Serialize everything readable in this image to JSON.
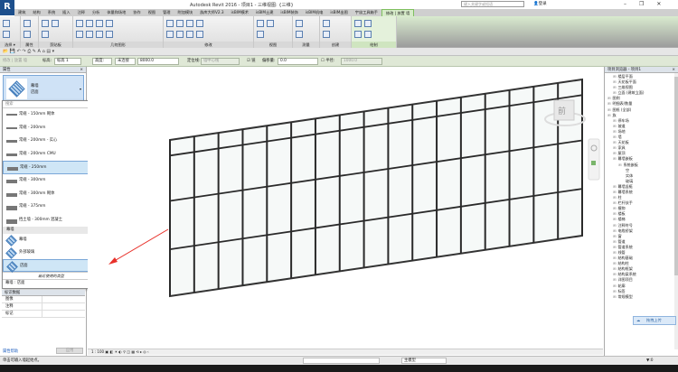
{
  "app": {
    "title": "Autodesk Revit 2016 -     项目1 - 三维视图: {三维}",
    "search_placeholder": "键入关键字或短语",
    "login": "登录",
    "accent": "#7fbf5f"
  },
  "tabs": [
    "建筑",
    "结构",
    "系统",
    "插入",
    "注释",
    "分析",
    "体量和场地",
    "协作",
    "视图",
    "管理",
    "附加模块",
    "族库大师V2.3",
    "isBIM模术",
    "isBIM土建",
    "isBIM装饰",
    "isBIM机电",
    "isBIM出图",
    "宇宙工具箱手",
    "修改 | 放置 墙"
  ],
  "active_tab": 18,
  "ribbon_panels": [
    {
      "label": "选择 ▾",
      "buttons": [
        "修改"
      ]
    },
    {
      "label": "属性",
      "buttons": []
    },
    {
      "label": "剪贴板",
      "buttons": [
        "粘贴"
      ]
    },
    {
      "label": "几何图形",
      "buttons": [
        "连接端切割",
        "剪切",
        "连接"
      ]
    },
    {
      "label": "修改",
      "buttons": []
    },
    {
      "label": "视图",
      "buttons": []
    },
    {
      "label": "测量",
      "buttons": []
    },
    {
      "label": "创建",
      "buttons": []
    },
    {
      "label": "绘制",
      "buttons": []
    }
  ],
  "options": {
    "mode": "修改 | 放置 墙",
    "level_label": "标高:",
    "level_value": "标高 1",
    "height_label": "高度:",
    "height_mode": "未连接",
    "height_value": "8000.0",
    "locline_label": "定位线:",
    "locline_value": "墙中心线",
    "chain_label": "链",
    "chain_checked": true,
    "offset_label": "偏移量:",
    "offset_value": "0.0",
    "radius_label": "半径:",
    "radius_checked": false,
    "radius_value": "1000.0"
  },
  "properties": {
    "title": "属性",
    "type_family": "幕墙",
    "type_name": "店面",
    "search_placeholder": "搜索",
    "types": [
      {
        "label": "常规 - 150mm 砌体"
      },
      {
        "label": "常规 - 200mm"
      },
      {
        "label": "常规 - 200mm - 实心"
      },
      {
        "label": "常规 - 200mm CMU"
      },
      {
        "label": "常规 - 250mm",
        "selected": true
      },
      {
        "label": "常规 - 300mm"
      },
      {
        "label": "常规 - 300mm 砌体"
      },
      {
        "label": "常规 - 375mm"
      },
      {
        "label": "挡土墙 - 300mm 混凝土"
      }
    ],
    "group": "幕墙",
    "families": [
      {
        "label": "幕墙"
      },
      {
        "label": "外部玻璃"
      },
      {
        "label": "店面",
        "selected": true
      }
    ],
    "recent": "最近使用的类型",
    "current": "幕墙 : 店面",
    "section": "标识数据",
    "rows": [
      {
        "name": "图像",
        "value": ""
      },
      {
        "name": "注释",
        "value": ""
      },
      {
        "name": "标记",
        "value": ""
      }
    ],
    "help": "属性帮助",
    "apply": "应用"
  },
  "view": {
    "scale": "1 : 100",
    "viewcube_face": "前",
    "annotation_color": "#e8312a",
    "curtain_wall": {
      "columns": 17,
      "row_grid_fractions": [
        0.1,
        0.39,
        0.7
      ]
    }
  },
  "browser": {
    "title": "项目浏览器 - 项目1",
    "items": [
      {
        "label": "楼层平面",
        "level": 1
      },
      {
        "label": "天花板平面",
        "level": 1
      },
      {
        "label": "三维视图",
        "level": 1
      },
      {
        "label": "立面 (建筑立面)",
        "level": 1
      },
      {
        "label": "图例",
        "level": 0
      },
      {
        "label": "明细表/数量",
        "level": 0
      },
      {
        "label": "图纸 (全部)",
        "level": 0
      },
      {
        "label": "族",
        "level": 0
      },
      {
        "label": "停车场",
        "level": 1
      },
      {
        "label": "坡道",
        "level": 1
      },
      {
        "label": "场地",
        "level": 1
      },
      {
        "label": "墙",
        "level": 1
      },
      {
        "label": "天花板",
        "level": 1
      },
      {
        "label": "家具",
        "level": 1
      },
      {
        "label": "屋顶",
        "level": 1
      },
      {
        "label": "幕墙嵌板",
        "level": 1
      },
      {
        "label": "系统嵌板",
        "level": 2
      },
      {
        "label": "空",
        "level": 3
      },
      {
        "label": "实体",
        "level": 3
      },
      {
        "label": "玻璃",
        "level": 3
      },
      {
        "label": "幕墙竖梃",
        "level": 1
      },
      {
        "label": "幕墙系统",
        "level": 1
      },
      {
        "label": "柱",
        "level": 1
      },
      {
        "label": "栏杆扶手",
        "level": 1
      },
      {
        "label": "植物",
        "level": 1
      },
      {
        "label": "楼板",
        "level": 1
      },
      {
        "label": "楼梯",
        "level": 1
      },
      {
        "label": "注释符号",
        "level": 1
      },
      {
        "label": "电缆桥架",
        "level": 1
      },
      {
        "label": "窗",
        "level": 1
      },
      {
        "label": "管道",
        "level": 1
      },
      {
        "label": "管道系统",
        "level": 1
      },
      {
        "label": "线管",
        "level": 1
      },
      {
        "label": "结构基础",
        "level": 1
      },
      {
        "label": "结构柱",
        "level": 1
      },
      {
        "label": "结构框架",
        "level": 1
      },
      {
        "label": "结构梁系统",
        "level": 1
      },
      {
        "label": "详图项目",
        "level": 1
      },
      {
        "label": "轮廓",
        "level": 1
      },
      {
        "label": "标签",
        "level": 1
      },
      {
        "label": "常规模型",
        "level": 1
      }
    ]
  },
  "upload_badge": "拖拽上传",
  "status": {
    "text": "单击可输入墙起始点。",
    "workset": "主模型",
    "filter_count": ":0"
  }
}
